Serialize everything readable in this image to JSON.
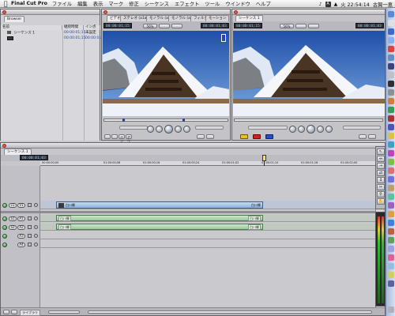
{
  "menubar": {
    "app_name": "Final Cut Pro",
    "items": [
      "ファイル",
      "編集",
      "表示",
      "マーク",
      "修正",
      "シーケンス",
      "エフェクト",
      "ツール",
      "ウインドウ",
      "ヘルプ"
    ],
    "clock": "火 22:54:14",
    "user": "古賀一恵"
  },
  "browser": {
    "tab": "Browser",
    "columns": [
      "名前",
      "継続時間",
      "イン点"
    ],
    "rows": [
      {
        "name": "シーケンス 1",
        "duration": "00:00:01;15",
        "in": "未設定"
      },
      {
        "name": "",
        "duration": "00:00:01;15",
        "in": "00:00:01;03"
      }
    ]
  },
  "viewer": {
    "tabs": [
      "ビデオ",
      "ステレオ (a1a2)",
      "モノラル (a1)",
      "モノラル (a2)",
      "フィルタ",
      "モーション"
    ],
    "timecode_left": "00:00:01;15",
    "timecode_right": "00:00:01;03",
    "zoom": "56%",
    "buttons": [
      "イン",
      "アウト"
    ]
  },
  "canvas": {
    "tab": "シーケンス 1",
    "timecode_left": "00:00:01;15",
    "timecode_right": "00:00:01;03",
    "zoom": "56%"
  },
  "timeline": {
    "tab": "シーケンス 1",
    "timecode": "00:00:01;03",
    "ruler_labels": [
      "00:00:00;00",
      "01:00:00;08",
      "01:00:00;16",
      "01:00:00;24",
      "01:00:01;02",
      "01:00:01;10",
      "01:00:01;18",
      "01:00:02;00"
    ],
    "tracks": [
      {
        "label": "v1",
        "target": "V1"
      },
      {
        "label": "a1",
        "target": "A1"
      },
      {
        "label": "a2",
        "target": "A2"
      },
      {
        "label": "A3",
        "target": ""
      },
      {
        "label": "A4",
        "target": ""
      }
    ],
    "clip_video_label": "白川郷",
    "clip_audio_label": "白川郷",
    "bottom_label": "ライブラリ"
  },
  "colors": {
    "timecode_text": "#a8c8f0",
    "video_clip": "#9cbce2",
    "audio_clip": "#a8d0a8",
    "sky": "#2b5aa8"
  }
}
